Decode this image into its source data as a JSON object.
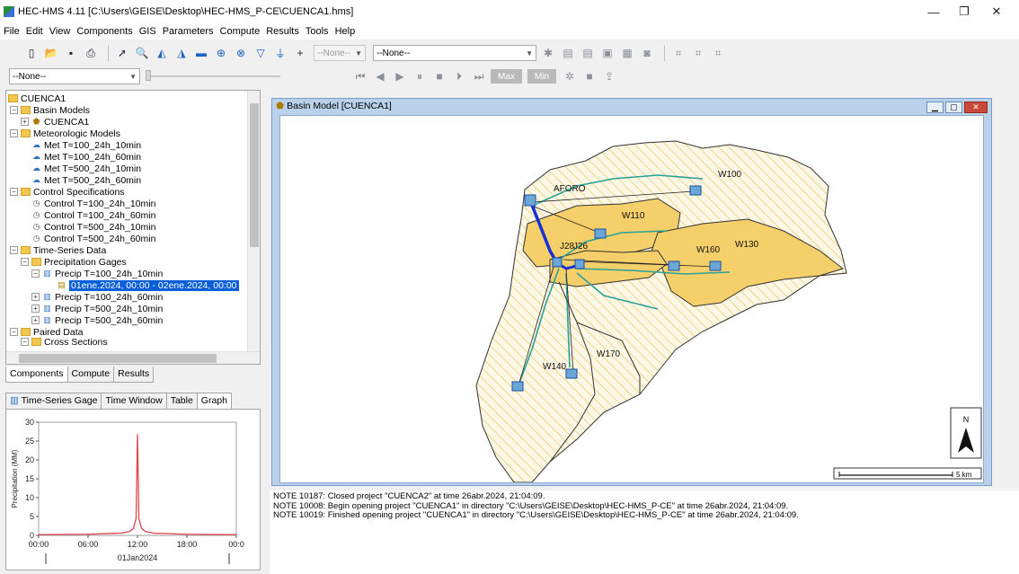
{
  "window": {
    "title": "HEC-HMS 4.11 [C:\\Users\\GEISE\\Desktop\\HEC-HMS_P-CE\\CUENCA1.hms]",
    "minimize": "—",
    "maximize": "❐",
    "close": "✕"
  },
  "menu": [
    "File",
    "Edit",
    "View",
    "Components",
    "GIS",
    "Parameters",
    "Compute",
    "Results",
    "Tools",
    "Help"
  ],
  "toolbar": {
    "combo1": "--None--",
    "combo2": "--None--",
    "combo3": "--None--",
    "max_label": "Max",
    "min_label": "Min"
  },
  "tree": {
    "root": "CUENCA1",
    "basin_models": "Basin Models",
    "basin_cuenca": "CUENCA1",
    "met_models": "Meteorologic Models",
    "met": [
      "Met T=100_24h_10min",
      "Met T=100_24h_60min",
      "Met T=500_24h_10min",
      "Met T=500_24h_60min"
    ],
    "control_specs": "Control Specifications",
    "control": [
      "Control T=100_24h_10min",
      "Control T=100_24h_60min",
      "Control T=500_24h_10min",
      "Control T=500_24h_60min"
    ],
    "ts_data": "Time-Series Data",
    "precip_gages": "Precipitation Gages",
    "precip": [
      "Precip T=100_24h_10min",
      "Precip T=100_24h_60min",
      "Precip T=500_24h_10min",
      "Precip T=500_24h_60min"
    ],
    "selected_window": "01ene.2024, 00:00 - 02ene.2024, 00:00",
    "paired_data": "Paired Data",
    "cross_sections": "Cross Sections"
  },
  "bottom_tabs": [
    "Components",
    "Compute",
    "Results"
  ],
  "graph_tabs": [
    "Time-Series Gage",
    "Time Window",
    "Table",
    "Graph"
  ],
  "chart_data": {
    "type": "line",
    "ylabel": "Precipitation (MM)",
    "xlabel": "01Jan2024",
    "y_ticks": [
      "30",
      "25",
      "20",
      "15",
      "10",
      "5",
      "0"
    ],
    "x_ticks": [
      "00:00",
      "06:00",
      "12:00",
      "18:00",
      "00:0"
    ],
    "ylim": [
      0,
      30
    ],
    "xlim_hours": [
      0,
      24
    ],
    "series": [
      {
        "x": [
          0,
          6,
          10,
          11,
          11.5,
          11.83,
          12,
          12.17,
          12.5,
          13,
          14,
          18,
          24
        ],
        "y": [
          0.2,
          0.3,
          0.6,
          1.0,
          1.8,
          4.5,
          26.8,
          4.5,
          1.8,
          1.0,
          0.6,
          0.3,
          0.2
        ]
      }
    ],
    "color": "#e0444c"
  },
  "basin": {
    "title": "Basin Model [CUENCA1]",
    "labels": [
      "AFORO",
      "W100",
      "W110",
      "W130",
      "W160",
      "J28",
      "J26",
      "W170",
      "W140"
    ],
    "north": "N",
    "scale": "5 km"
  },
  "log": [
    "NOTE 10187:  Closed project \"CUENCA2\" at time 26abr.2024, 21:04:09.",
    "NOTE 10008:  Begin opening project \"CUENCA1\" in directory \"C:\\Users\\GEISE\\Desktop\\HEC-HMS_P-CE\" at time 26abr.2024, 21:04:09.",
    "NOTE 10019:  Finished opening project \"CUENCA1\" in directory \"C:\\Users\\GEISE\\Desktop\\HEC-HMS_P-CE\" at time 26abr.2024, 21:04:09."
  ]
}
